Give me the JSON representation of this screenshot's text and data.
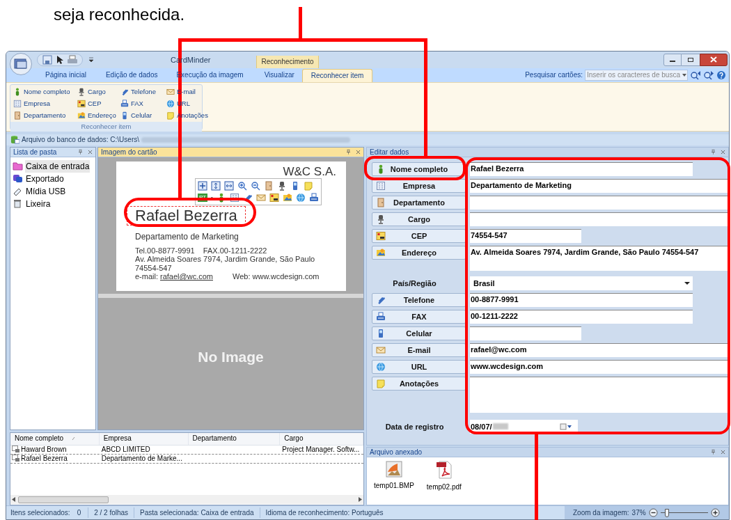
{
  "instruction": "seja reconhecida.",
  "window": {
    "title": "CardMinder",
    "context_tab": "Reconhecimento"
  },
  "tabs": [
    {
      "label": "Página inicial",
      "selected": false
    },
    {
      "label": "Edição de dados",
      "selected": false
    },
    {
      "label": "Execução da imagem",
      "selected": false
    },
    {
      "label": "Visualizar",
      "selected": false
    },
    {
      "label": "Reconhecer item",
      "selected": true
    }
  ],
  "search": {
    "label": "Pesquisar cartões:",
    "placeholder": "Inserir os caracteres de busca"
  },
  "ribbon_group": {
    "title": "Reconhecer item",
    "items": [
      "Nome completo",
      "Cargo",
      "Telefone",
      "E-mail",
      "Empresa",
      "CEP",
      "FAX",
      "URL",
      "Departamento",
      "Endereço",
      "Celular",
      "Anotações"
    ]
  },
  "database_path": "Arquivo do banco de dados: C:\\Users\\",
  "folder_panel": {
    "title": "Lista de pasta",
    "items": [
      {
        "label": "Caixa de entrada",
        "selected": true
      },
      {
        "label": "Exportado",
        "selected": false
      },
      {
        "label": "Mídia USB",
        "selected": false
      },
      {
        "label": "Lixeira",
        "selected": false
      }
    ]
  },
  "card_panel": {
    "title": "Imagem do cartão",
    "card": {
      "company": "W&C S.A.",
      "name": "Rafael Bezerra",
      "department": "Departamento de Marketing",
      "phone_line": "Tel.00-8877-9991    FAX.00-1211-2222",
      "address_lines": [
        "Av. Almeida Soares 7974, Jardim Grande, São Paulo",
        "74554-547"
      ],
      "email_label": "e-mail:",
      "email": "rafael@wc.com",
      "web": "Web: www.wcdesign.com"
    },
    "toolbar_language": "PT",
    "no_image": "No Image"
  },
  "edit_panel": {
    "title": "Editar dados",
    "fields": [
      {
        "label": "Nome completo",
        "kind": "text",
        "value": "Rafael Bezerra"
      },
      {
        "label": "Empresa",
        "kind": "text",
        "value": "Departamento de Marketing"
      },
      {
        "label": "Departamento",
        "kind": "text"
      },
      {
        "label": "Cargo",
        "kind": "text"
      },
      {
        "label": "CEP",
        "kind": "text",
        "value": "74554-547"
      },
      {
        "label": "Endereço",
        "kind": "multiline",
        "value": "Av. Almeida Soares 7974, Jardim Grande, São Paulo 74554-547"
      },
      {
        "label": "País/Região",
        "kind": "select",
        "value": "Brasil"
      },
      {
        "label": "Telefone",
        "kind": "text",
        "value": "00-8877-9991"
      },
      {
        "label": "FAX",
        "kind": "text",
        "value": "00-1211-2222"
      },
      {
        "label": "Celular",
        "kind": "text"
      },
      {
        "label": "E-mail",
        "kind": "text",
        "value": "rafael@wc.com"
      },
      {
        "label": "URL",
        "kind": "text",
        "value": "www.wcdesign.com"
      },
      {
        "label": "Anotações",
        "kind": "multiline"
      },
      {
        "label": "Data de registro",
        "kind": "date",
        "value": "08/07/"
      }
    ]
  },
  "card_list": {
    "columns": [
      "Nome completo",
      "Empresa",
      "Departamento",
      "Cargo"
    ],
    "rows": [
      {
        "name": "Haward Brown",
        "company": "ABCD LIMITED",
        "title": "Project Manager. Softw..."
      },
      {
        "name": "Rafael Bezerra",
        "company": "Departamento de Marke..."
      }
    ]
  },
  "attachments": {
    "title": "Arquivo anexado",
    "files": [
      {
        "name": "temp01.BMP",
        "kind": "image"
      },
      {
        "name": "temp02.pdf",
        "kind": "pdf"
      }
    ]
  },
  "status_bar": {
    "items": [
      "Itens selecionados:",
      "0",
      "2 / 2 folhas",
      "Pasta selecionada: Caixa de entrada",
      "Idioma de reconhecimento: Português"
    ],
    "zoom": {
      "label": "Zoom da imagem:",
      "value": "37%",
      "level": 0.1
    }
  }
}
